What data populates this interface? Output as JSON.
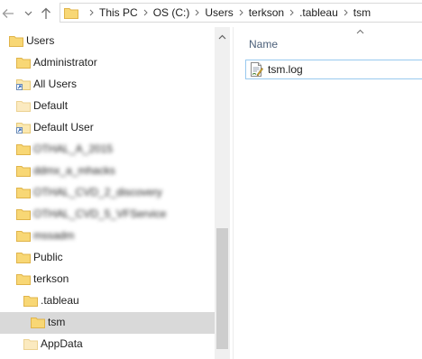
{
  "address_bar": {
    "breadcrumbs": [
      "This PC",
      "OS (C:)",
      "Users",
      "terkson",
      ".tableau",
      "tsm"
    ]
  },
  "tree": {
    "items": [
      {
        "label": "Users",
        "icon": "folder-icon",
        "selected": false
      },
      {
        "label": "Administrator",
        "icon": "folder-icon",
        "selected": false
      },
      {
        "label": "All Users",
        "icon": "folder-shortcut-icon",
        "selected": false
      },
      {
        "label": "Default",
        "icon": "folder-light-icon",
        "selected": false
      },
      {
        "label": "Default User",
        "icon": "folder-shortcut-icon",
        "selected": false
      },
      {
        "label": "OTHAL_A_2015",
        "icon": "folder-icon",
        "selected": false,
        "blurred": true
      },
      {
        "label": "ddmx_a_mhacks",
        "icon": "folder-icon",
        "selected": false,
        "blurred": true
      },
      {
        "label": "OTHAL_CVD_2_discovery",
        "icon": "folder-icon",
        "selected": false,
        "blurred": true
      },
      {
        "label": "OTHAL_CVD_5_VFService",
        "icon": "folder-icon",
        "selected": false,
        "blurred": true
      },
      {
        "label": "mssadm",
        "icon": "folder-icon",
        "selected": false,
        "blurred": true
      },
      {
        "label": "Public",
        "icon": "folder-icon",
        "selected": false
      },
      {
        "label": "terkson",
        "icon": "folder-icon",
        "selected": false
      },
      {
        "label": ".tableau",
        "icon": "folder-icon",
        "selected": false
      },
      {
        "label": "tsm",
        "icon": "folder-icon",
        "selected": true
      },
      {
        "label": "AppData",
        "icon": "folder-light-icon",
        "selected": false
      }
    ]
  },
  "file_pane": {
    "column_name": "Name",
    "files": [
      {
        "name": "tsm.log",
        "icon": "log-file-icon",
        "selected": true
      }
    ]
  },
  "colors": {
    "folder": "#f8d775",
    "folder_dark": "#e0b44a",
    "selection": "#d9d9d9",
    "file_selection_border": "#99c9ef",
    "header_text": "#4c607a"
  }
}
